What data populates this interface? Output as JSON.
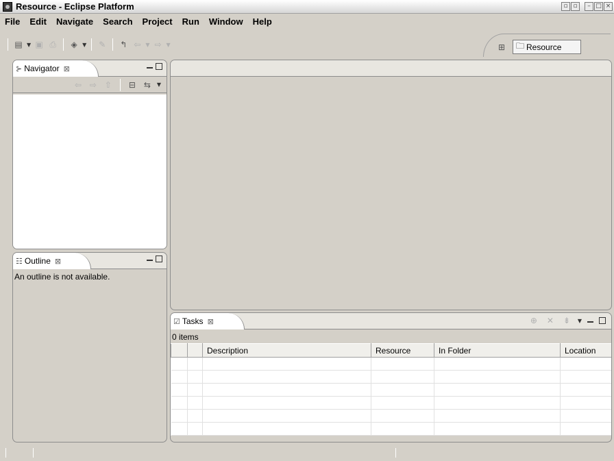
{
  "window": {
    "title": "Resource - Eclipse Platform"
  },
  "menu": {
    "items": [
      "File",
      "Edit",
      "Navigate",
      "Search",
      "Project",
      "Run",
      "Window",
      "Help"
    ]
  },
  "perspective": {
    "label": "Resource"
  },
  "navigator": {
    "title": "Navigator"
  },
  "outline": {
    "title": "Outline",
    "message": "An outline is not available."
  },
  "tasks": {
    "title": "Tasks",
    "count": "0 items",
    "columns": [
      "",
      "",
      "Description",
      "Resource",
      "In Folder",
      "Location"
    ]
  }
}
